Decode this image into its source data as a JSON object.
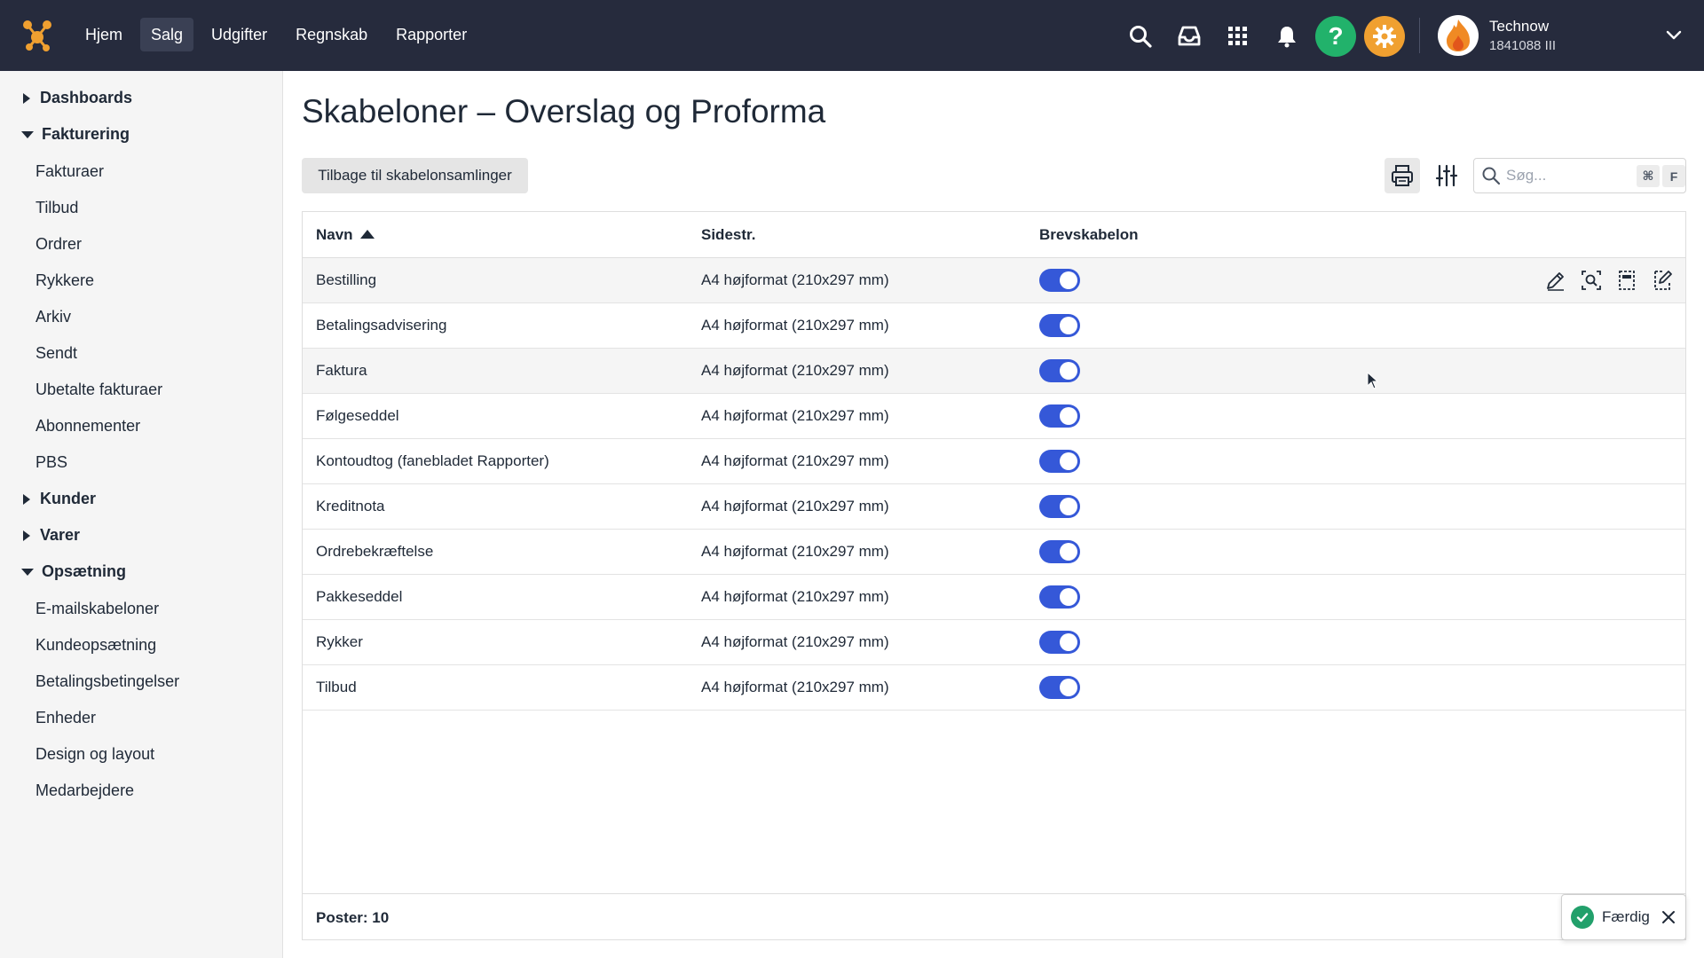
{
  "topbar": {
    "nav": [
      {
        "label": "Hjem",
        "active": false
      },
      {
        "label": "Salg",
        "active": true
      },
      {
        "label": "Udgifter",
        "active": false
      },
      {
        "label": "Regnskab",
        "active": false
      },
      {
        "label": "Rapporter",
        "active": false
      }
    ],
    "icons": [
      "search-icon",
      "inbox-icon",
      "apps-grid-icon",
      "bell-icon",
      "help-icon",
      "gear-icon"
    ],
    "help_glyph": "?",
    "user": {
      "name": "Technow",
      "id": "1841088 III"
    }
  },
  "sidebar": {
    "groups": [
      {
        "label": "Dashboards",
        "expanded": false,
        "items": []
      },
      {
        "label": "Fakturering",
        "expanded": true,
        "items": [
          "Fakturaer",
          "Tilbud",
          "Ordrer",
          "Rykkere",
          "Arkiv",
          "Sendt",
          "Ubetalte fakturaer",
          "Abonnementer",
          "PBS"
        ]
      },
      {
        "label": "Kunder",
        "expanded": false,
        "items": []
      },
      {
        "label": "Varer",
        "expanded": false,
        "items": []
      },
      {
        "label": "Opsætning",
        "expanded": true,
        "items": [
          "E-mailskabeloner",
          "Kundeopsætning",
          "Betalingsbetingelser",
          "Enheder",
          "Design og layout",
          "Medarbejdere"
        ]
      }
    ]
  },
  "main": {
    "title": "Skabeloner – Overslag og Proforma",
    "back_button": "Tilbage til skabelonsamlinger",
    "search": {
      "placeholder": "Søg...",
      "shortcut_mod": "⌘",
      "shortcut_key": "F"
    },
    "table": {
      "columns": {
        "name": "Navn",
        "size": "Sidestr.",
        "letter": "Brevskabelon"
      },
      "sort": {
        "column": "Navn",
        "direction": "ascending"
      },
      "rows": [
        {
          "name": "Bestilling",
          "size": "A4 højformat (210x297 mm)",
          "letter": true
        },
        {
          "name": "Betalingsadvisering",
          "size": "A4 højformat (210x297 mm)",
          "letter": true
        },
        {
          "name": "Faktura",
          "size": "A4 højformat (210x297 mm)",
          "letter": true
        },
        {
          "name": "Følgeseddel",
          "size": "A4 højformat (210x297 mm)",
          "letter": true
        },
        {
          "name": "Kontoudtog (fanebladet Rapporter)",
          "size": "A4 højformat (210x297 mm)",
          "letter": true
        },
        {
          "name": "Kreditnota",
          "size": "A4 højformat (210x297 mm)",
          "letter": true
        },
        {
          "name": "Ordrebekræftelse",
          "size": "A4 højformat (210x297 mm)",
          "letter": true
        },
        {
          "name": "Pakkeseddel",
          "size": "A4 højformat (210x297 mm)",
          "letter": true
        },
        {
          "name": "Rykker",
          "size": "A4 højformat (210x297 mm)",
          "letter": true
        },
        {
          "name": "Tilbud",
          "size": "A4 højformat (210x297 mm)",
          "letter": true
        }
      ],
      "row_action_icons": [
        "edit-icon",
        "preview-icon",
        "layout-icon",
        "edit-document-icon"
      ],
      "footer": "Poster: 10"
    }
  },
  "toast": {
    "text": "Færdig"
  },
  "colors": {
    "topbar": "#262b3d",
    "toggle_on": "#3558d8",
    "help": "#22b26b",
    "gear": "#f0a030",
    "success": "#22a06b"
  }
}
